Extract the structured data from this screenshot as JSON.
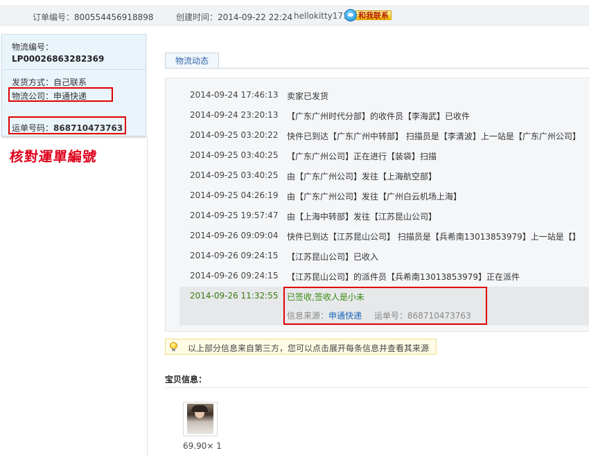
{
  "order": {
    "number_label": "订单编号：",
    "number_value": "800554456918898",
    "created_label": "创建时间：",
    "created_value": "2014-09-22 22:24",
    "seller": "hellokitty1717",
    "chat_label": "和我联系"
  },
  "logistics_panel": {
    "id_label": "物流编号：",
    "id_value": "LP00026863282369",
    "ship_method": "发货方式：自己联系",
    "company": "物流公司：申通快递",
    "waybill_label": "运单号码：",
    "waybill_value": "868710473763"
  },
  "annotation": {
    "handwritten_note": "核對運單編號",
    "highlight_color": "#e00000"
  },
  "tabs": [
    {
      "label": "物流动态"
    }
  ],
  "tracking": [
    {
      "time": "2014-09-24 17:46:13",
      "desc": "卖家已发货"
    },
    {
      "time": "2014-09-24 23:20:13",
      "desc": "【广东广州时代分部】的收件员【李海武】已收件"
    },
    {
      "time": "2014-09-25 03:20:22",
      "desc": "快件已到达【广东广州中转部】 扫描员是【李清波】上一站是【广东广州公司】"
    },
    {
      "time": "2014-09-25 03:40:25",
      "desc": "【广东广州公司】正在进行【装袋】扫描"
    },
    {
      "time": "2014-09-25 03:40:25",
      "desc": "由【广东广州公司】发往【上海航空部】"
    },
    {
      "time": "2014-09-25 04:26:19",
      "desc": "由【广东广州公司】发往【广州白云机场上海】"
    },
    {
      "time": "2014-09-25 19:57:47",
      "desc": "由【上海中转部】发往【江苏昆山公司】"
    },
    {
      "time": "2014-09-26 09:09:04",
      "desc": "快件已到达【江苏昆山公司】 扫描员是【兵希南13013853979】上一站是【】"
    },
    {
      "time": "2014-09-26 09:24:15",
      "desc": "【江苏昆山公司】已收入"
    },
    {
      "time": "2014-09-26 09:24:15",
      "desc": "【江苏昆山公司】的派件员【兵希南13013853979】正在派件"
    }
  ],
  "tracking_last": {
    "time": "2014-09-26 11:32:55",
    "desc": "已签收,签收人是小未",
    "source_label": "信息来源：",
    "source_link": "申通快递",
    "waybill_text": "运单号：868710473763"
  },
  "notice": {
    "icon": "lightbulb-icon",
    "text": "以上部分信息来自第三方，您可以点击展开每条信息并查看其来源"
  },
  "item_section": {
    "title": "宝贝信息：",
    "price_qty": "69.90× 1"
  }
}
